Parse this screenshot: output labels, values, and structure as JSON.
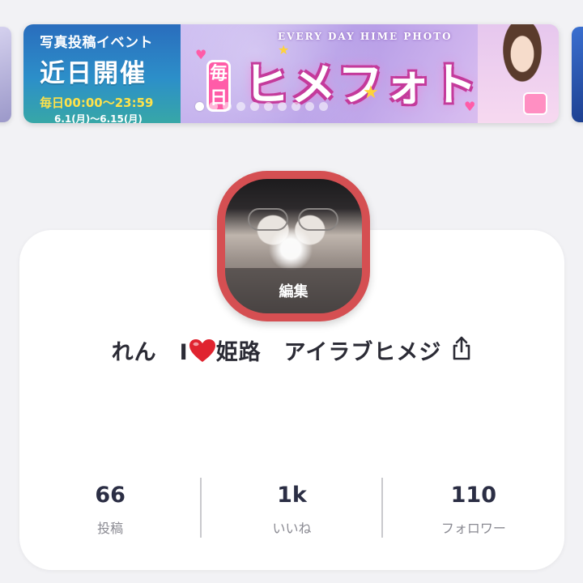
{
  "banner": {
    "event_title": "写真投稿イベント",
    "event_status": "近日開催",
    "event_hours": "毎日00:00～23:59",
    "event_dates": "6.1(月)～6.15(月)",
    "tagline": "EVERY DAY HIME PHOTO",
    "daily_label": "毎日",
    "main_title": "ヒメフォト",
    "dot_count": 10,
    "active_dot": 0,
    "accent_pink": "#ff5ca8",
    "accent_blue": "#2a6dbd"
  },
  "profile": {
    "avatar_edit_label": "編集",
    "avatar_ring_color": "#d54f52",
    "name_prefix": "れん　I",
    "name_suffix": "姫路　アイラブヒメジ",
    "heart_color": "#e0232f",
    "share_icon": "share-icon"
  },
  "stats": [
    {
      "value": "66",
      "label": "投稿"
    },
    {
      "value": "1k",
      "label": "いいね"
    },
    {
      "value": "110",
      "label": "フォロワー"
    }
  ]
}
